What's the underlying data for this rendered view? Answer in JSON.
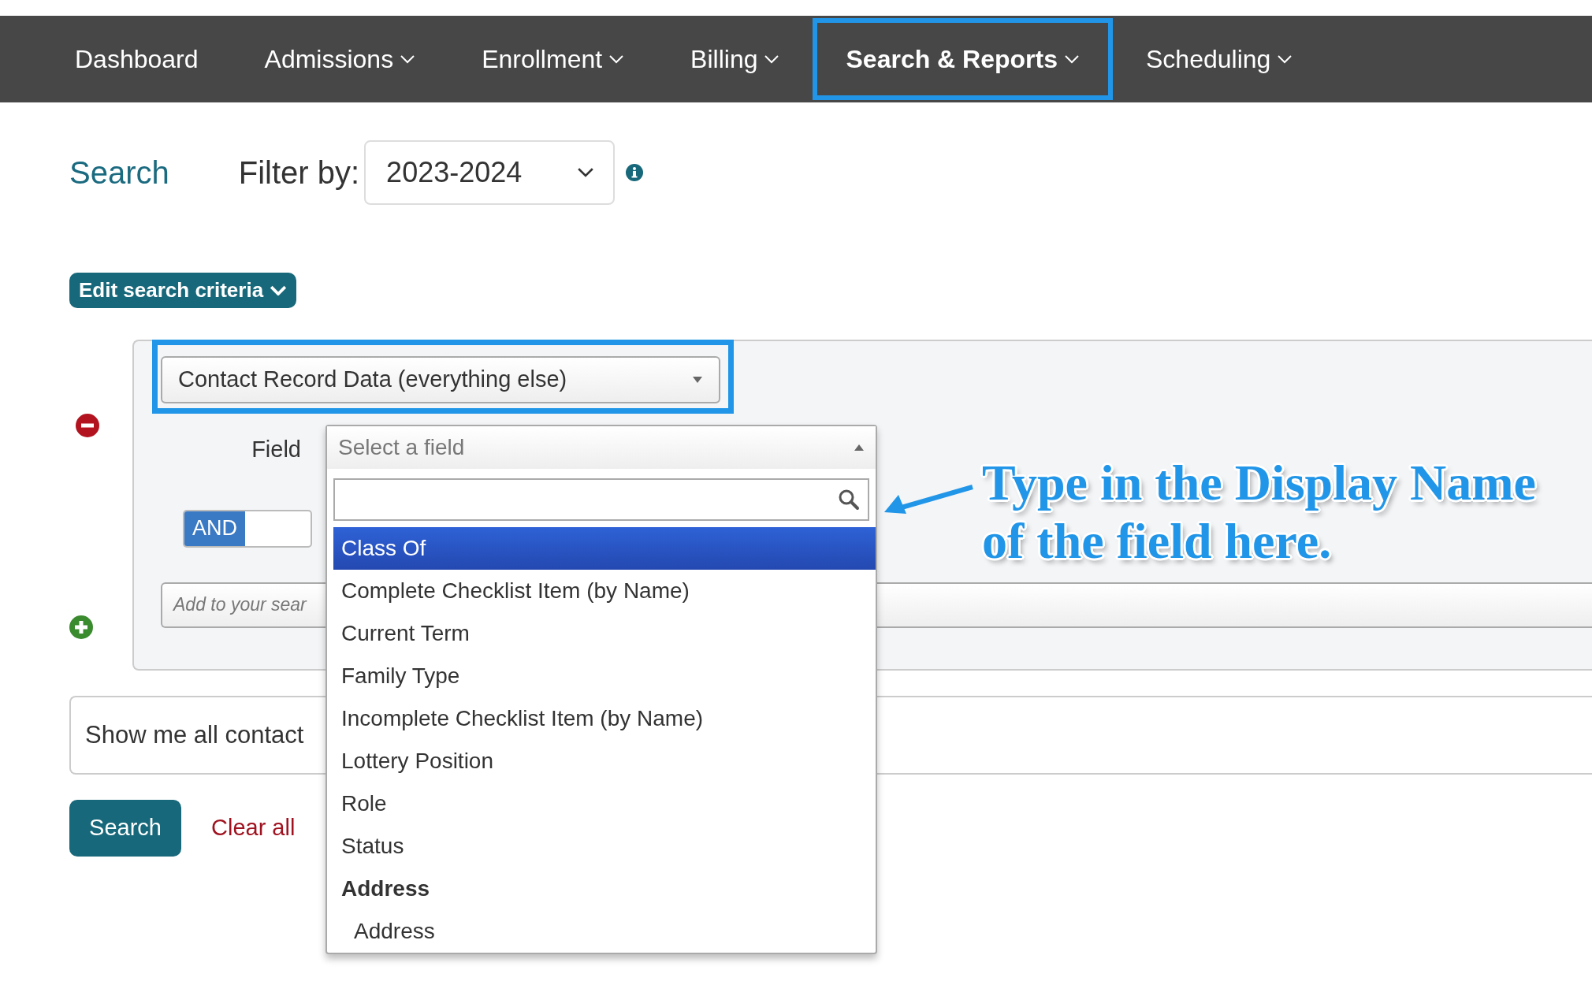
{
  "nav": [
    {
      "label": "Dashboard",
      "has_menu": false,
      "highlighted": false
    },
    {
      "label": "Admissions",
      "has_menu": true,
      "highlighted": false
    },
    {
      "label": "Enrollment",
      "has_menu": true,
      "highlighted": false
    },
    {
      "label": "Billing",
      "has_menu": true,
      "highlighted": false
    },
    {
      "label": "Search & Reports",
      "has_menu": true,
      "highlighted": true
    },
    {
      "label": "Scheduling",
      "has_menu": true,
      "highlighted": false
    }
  ],
  "page_title": "Search",
  "filter": {
    "label": "Filter by:",
    "value": "2023-2024"
  },
  "edit_criteria_button": "Edit search criteria",
  "criteria": {
    "source": {
      "value": "Contact Record Data (everything else)",
      "highlighted": true
    },
    "field_label": "Field",
    "field_select": {
      "placeholder": "Select a field",
      "expanded": true,
      "options": [
        {
          "label": "Class Of",
          "kind": "option",
          "selected": true
        },
        {
          "label": "Complete Checklist Item (by Name)",
          "kind": "option",
          "selected": false
        },
        {
          "label": "Current Term",
          "kind": "option",
          "selected": false
        },
        {
          "label": "Family Type",
          "kind": "option",
          "selected": false
        },
        {
          "label": "Incomplete Checklist Item (by Name)",
          "kind": "option",
          "selected": false
        },
        {
          "label": "Lottery Position",
          "kind": "option",
          "selected": false
        },
        {
          "label": "Role",
          "kind": "option",
          "selected": false
        },
        {
          "label": "Status",
          "kind": "option",
          "selected": false
        },
        {
          "label": "Address",
          "kind": "group"
        },
        {
          "label": "Address",
          "kind": "suboption",
          "selected": false
        }
      ]
    },
    "connector": {
      "label": "AND",
      "on": true
    },
    "add_field": {
      "placeholder": "Add to your sear"
    }
  },
  "summary": "Show me all contact",
  "search_button": "Search",
  "clear_link": "Clear all",
  "annotation": {
    "lines": [
      "Type in the Display Name",
      "of the field here."
    ]
  }
}
